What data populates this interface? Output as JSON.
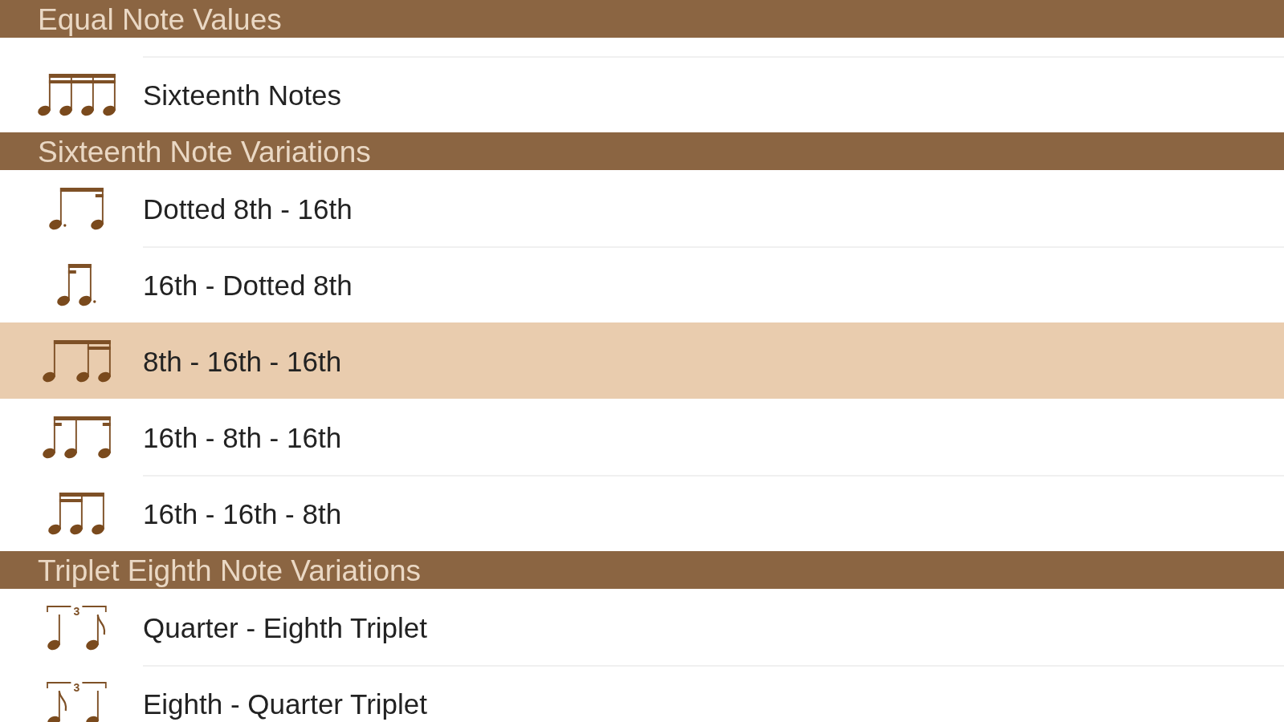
{
  "sections": [
    {
      "title": "Equal Note Values",
      "rows": [
        {
          "label": "Sixteenth Notes",
          "kind": "sixteenths",
          "selected": false
        }
      ]
    },
    {
      "title": "Sixteenth Note Variations",
      "rows": [
        {
          "label": "Dotted 8th - 16th",
          "kind": "dotted-eighth-sixteenth",
          "selected": false
        },
        {
          "label": "16th - Dotted 8th",
          "kind": "sixteenth-dotted-eighth",
          "selected": false
        },
        {
          "label": "8th - 16th - 16th",
          "kind": "eighth-sixteenth-sixteenth",
          "selected": true
        },
        {
          "label": "16th - 8th - 16th",
          "kind": "sixteenth-eighth-sixteenth",
          "selected": false
        },
        {
          "label": "16th - 16th - 8th",
          "kind": "sixteenth-sixteenth-eighth",
          "selected": false
        }
      ]
    },
    {
      "title": "Triplet Eighth Note Variations",
      "rows": [
        {
          "label": "Quarter - Eighth Triplet",
          "kind": "quarter-eighth",
          "tuplet": "3",
          "selected": false
        },
        {
          "label": "Eighth - Quarter Triplet",
          "kind": "eighth-quarter",
          "tuplet": "3",
          "selected": false
        }
      ]
    }
  ]
}
